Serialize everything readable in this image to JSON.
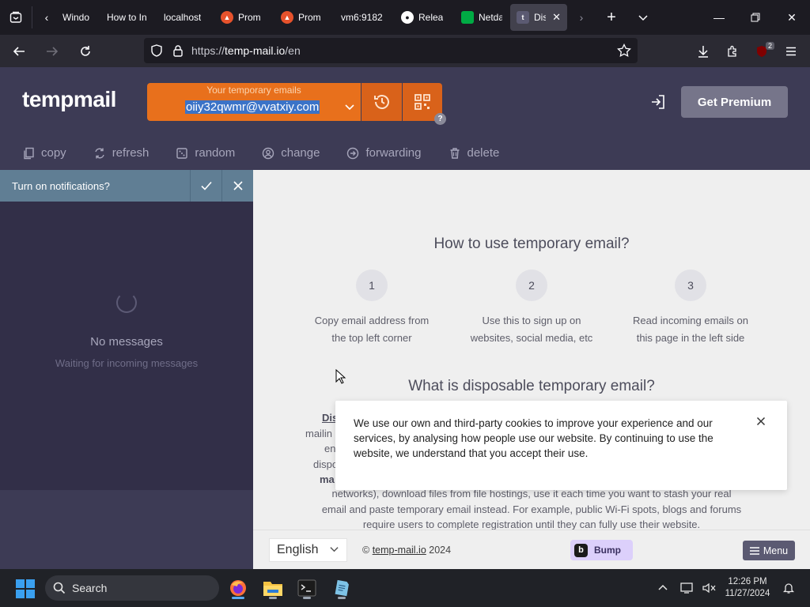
{
  "browser": {
    "tabs": [
      {
        "title": "Windo",
        "favicon": "windows-icon",
        "color": "#1c1b22"
      },
      {
        "title": "How to In",
        "favicon": "none",
        "color": "#1c1b22"
      },
      {
        "title": "localhost",
        "favicon": "none",
        "color": "#1c1b22"
      },
      {
        "title": "Prom",
        "favicon": "prometheus-icon",
        "color": "#e6522c"
      },
      {
        "title": "Prom",
        "favicon": "prometheus-icon",
        "color": "#e6522c"
      },
      {
        "title": "vm6:9182",
        "favicon": "none",
        "color": "#1c1b22"
      },
      {
        "title": "Relea",
        "favicon": "github-icon",
        "color": "#ffffff"
      },
      {
        "title": "Netda",
        "favicon": "netdata-icon",
        "color": "#00ab44"
      },
      {
        "title": "Dis",
        "favicon": "tempmail-icon",
        "color": "#42414d",
        "active": true
      }
    ],
    "url_prefix": "https://",
    "url_domain": "temp-mail.io",
    "url_path": "/en",
    "extension_badge": "2"
  },
  "site": {
    "logo": "tempmail",
    "email_caption": "Your temporary emails",
    "email": "oiiy32qwmr@vvatxiy.com",
    "help": "?",
    "premium_label": "Get Premium",
    "actions": [
      {
        "label": "copy",
        "icon": "copy-icon"
      },
      {
        "label": "refresh",
        "icon": "refresh-icon"
      },
      {
        "label": "random",
        "icon": "random-icon"
      },
      {
        "label": "change",
        "icon": "change-icon"
      },
      {
        "label": "forwarding",
        "icon": "forwarding-icon"
      },
      {
        "label": "delete",
        "icon": "trash-icon"
      }
    ]
  },
  "inbox": {
    "notification_prompt": "Turn on notifications?",
    "empty_title": "No messages",
    "empty_subtitle": "Waiting for incoming messages"
  },
  "content": {
    "how_title": "How to use temporary email?",
    "steps": [
      {
        "num": "1",
        "line1": "Copy email address from",
        "line2": "the top left corner"
      },
      {
        "num": "2",
        "line1": "Use this to sign up on",
        "line2": "websites, social media, etc"
      },
      {
        "num": "3",
        "line1": "Read incoming emails on",
        "line2": "this page in the left side"
      }
    ],
    "what_title": "What is disposable temporary email?",
    "frag_dis": "Dis",
    "frag_mailin": "mailin",
    "frag_en": "en",
    "frag_dispo": "dispo",
    "frag_ma": "ma",
    "para_line1": "networks), download files from file hostings, use it each time you want to stash your real",
    "para_line2": "email and paste temporary email instead. For example, public Wi-Fi spots, blogs and forums",
    "para_line3": "require users to complete registration until they can fully use their website."
  },
  "cookie": {
    "text": "We use our own and third-party cookies to improve your experience and our services, by analysing how people use our website. By continuing to use the website, we understand that you accept their use."
  },
  "footer": {
    "language": "English",
    "copyright_prefix": "©",
    "copyright_link": "temp-mail.io",
    "copyright_year": "2024",
    "bump_icon": "b",
    "bump_label": "Bump",
    "menu_label": "Menu"
  },
  "taskbar": {
    "search_label": "Search",
    "time": "12:26 PM",
    "date": "11/27/2024"
  }
}
